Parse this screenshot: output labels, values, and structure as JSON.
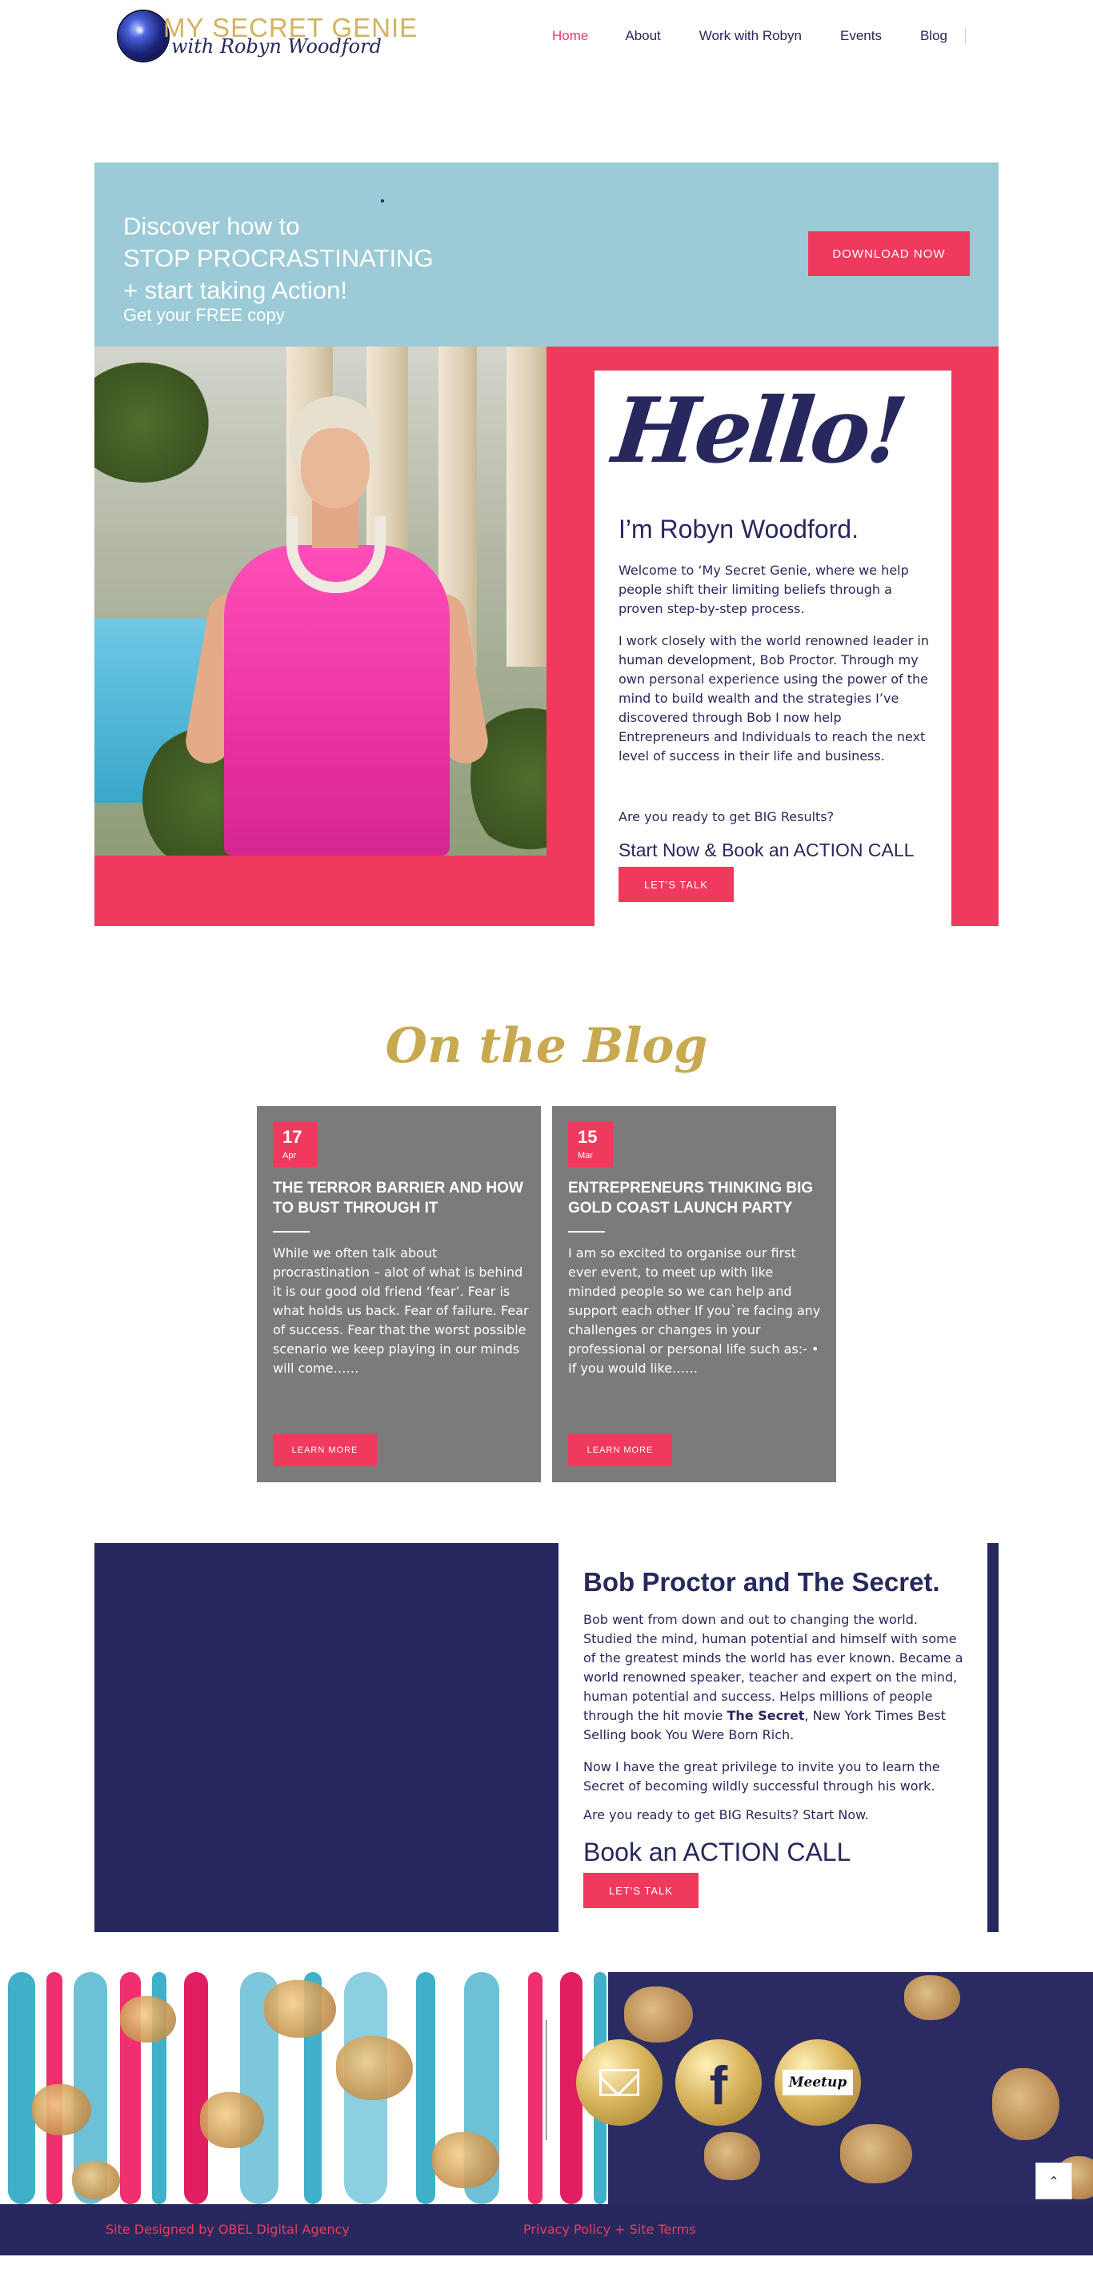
{
  "header": {
    "logo_title": "MY SECRET GENIE",
    "logo_subtitle": "with Robyn Woodford",
    "nav": [
      {
        "label": "Home",
        "active": true
      },
      {
        "label": "About",
        "active": false
      },
      {
        "label": "Work with Robyn",
        "active": false
      },
      {
        "label": "Events",
        "active": false
      },
      {
        "label": "Blog",
        "active": false
      }
    ]
  },
  "banner": {
    "line1": "Discover how to",
    "line2": "STOP PROCRASTINATING",
    "line3": "+ start taking Action!",
    "subline": "Get your FREE copy",
    "button": "DOWNLOAD NOW"
  },
  "intro": {
    "hello": "Hello!",
    "name": "I’m Robyn Woodford.",
    "p1": "Welcome to ‘My Secret Genie, where we help people shift their limiting beliefs through a proven step-by-step process.",
    "p2": "I work closely with the world renowned leader in human development, Bob Proctor. Through my own personal experience using the power of the mind to build wealth and the strategies I’ve discovered through Bob I now help Entrepreneurs and Individuals to reach the next level of success in their life and business.",
    "question": "Are you ready to get BIG Results?",
    "cta": "Start Now & Book an ACTION CALL",
    "button": "LET'S TALK"
  },
  "blog": {
    "title": "On the Blog",
    "posts": [
      {
        "day": "17",
        "month": "Apr",
        "title": "THE TERROR BARRIER AND HOW TO BUST THROUGH IT",
        "excerpt": "While we often talk about procrastination – alot of what is behind it is our good old friend ‘fear’. Fear is what holds us back. Fear of failure. Fear of success. Fear that the worst possible scenario we keep playing in our minds will come……",
        "button": "LEARN MORE"
      },
      {
        "day": "15",
        "month": "Mar",
        "title": "ENTREPRENEURS THINKING BIG GOLD COAST LAUNCH PARTY",
        "excerpt": "I am so excited to organise our first ever event, to meet up with like minded people so we can help and support each other If you`re facing any challenges or changes in your professional or personal life such as:- • If you would like……",
        "button": "LEARN MORE"
      }
    ]
  },
  "bob": {
    "title": "Bob Proctor and The Secret.",
    "p1_before": "Bob went from down and out to changing the world. Studied the mind, human potential and himself with some of the greatest minds the world has ever known. Became a world renowned speaker, teacher and expert on the mind, human potential and success. Helps millions of people through the hit movie ",
    "p1_bold": "The Secret",
    "p1_after": ", New York Times Best Selling book You Were Born Rich.",
    "p2": "Now I have the great privilege to invite you to learn the Secret of becoming wildly successful through his work.",
    "p3": "Are you ready to get BIG Results? Start Now.",
    "cta": "Book an ACTION CALL",
    "button": "LET'S TALK"
  },
  "social": {
    "icons": [
      "mail-icon",
      "facebook-icon",
      "meetup-icon"
    ],
    "meetup_text": "Meetup",
    "facebook_text": "f"
  },
  "back_to_top": {
    "icon": "chevron-up-icon",
    "glyph": "⌃"
  },
  "footer": {
    "left": "Site Designed by OBEL Digital Agency",
    "right": "Privacy Policy + Site Terms"
  },
  "colors": {
    "navy": "#27285e",
    "pink": "#ef3a5d",
    "banner_blue": "#9ccad7",
    "gold": "#c9a94f",
    "card_grey": "#7b7b7b"
  }
}
